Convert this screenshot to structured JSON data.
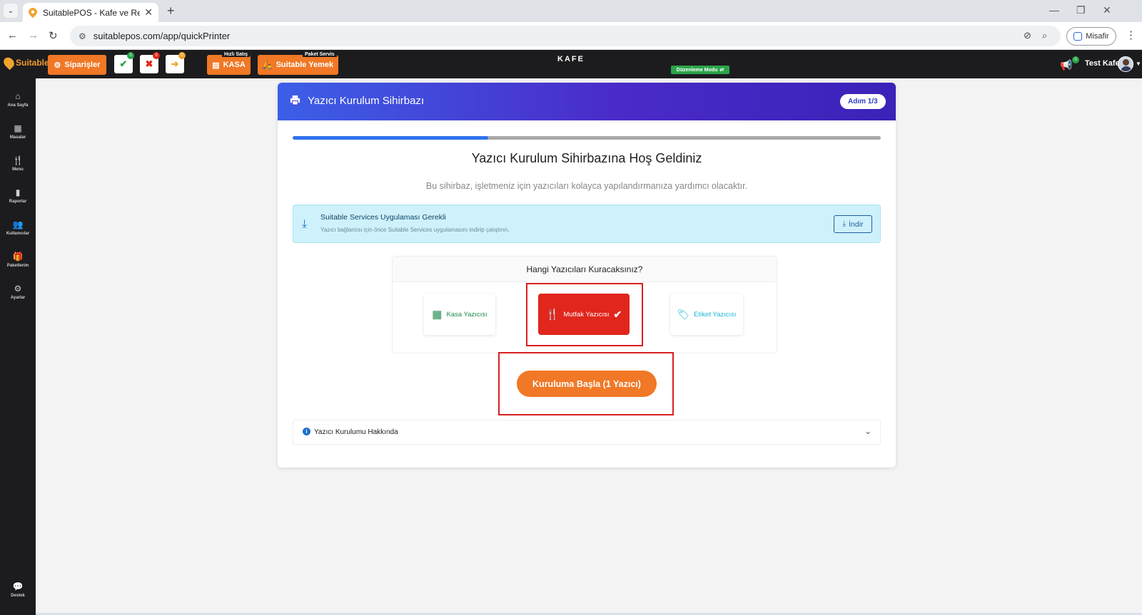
{
  "browser": {
    "tab_title": "SuitablePOS - Kafe ve Restoran",
    "url": "suitablepos.com/app/quickPrinter",
    "guest_label": "Misafir"
  },
  "app": {
    "logo_text": "Suitable",
    "orders_label": "Siparişler",
    "badges": {
      "approved": "0",
      "cancelled": "0",
      "pending": "0"
    },
    "quick_sale_caption": "Hızlı Satış",
    "kasa_label": "KASA",
    "package_caption": "Paket Servis",
    "suitable_yemek_label": "Suitable Yemek",
    "venue": "KAFE",
    "edit_mode": "Düzenleme Modu",
    "notif_count": "0",
    "user_name": "Test Kafe"
  },
  "sidebar": {
    "items": [
      {
        "label": "Ana Sayfa",
        "icon": "home-icon"
      },
      {
        "label": "Masalar",
        "icon": "table-icon"
      },
      {
        "label": "Menu",
        "icon": "utensils-icon"
      },
      {
        "label": "Raporlar",
        "icon": "report-icon"
      },
      {
        "label": "Kullanıcılar",
        "icon": "users-icon"
      },
      {
        "label": "Paketlerim",
        "icon": "gift-icon"
      },
      {
        "label": "Ayarlar",
        "icon": "cogs-icon"
      }
    ],
    "support_label": "Destek"
  },
  "wizard": {
    "title": "Yazıcı Kurulum Sihirbazı",
    "step": "Adım 1/3",
    "progress_fraction": 0.333,
    "welcome": "Yazıcı Kurulum Sihirbazına Hoş Geldiniz",
    "subtitle": "Bu sihirbaz, işletmeniz için yazıcıları kolayca yapılandırmanıza yardımcı olacaktır.",
    "alert_title": "Suitable Services Uygulaması Gerekli",
    "alert_text": "Yazıcı bağlantısı için önce Suitable Services uygulamasını indirip çalıştırın.",
    "download_label": "İndir",
    "question": "Hangi Yazıcıları Kuracaksınız?",
    "printers": [
      {
        "label": "Kasa Yazıcısı",
        "selected": false,
        "color": "#1e8a4c"
      },
      {
        "label": "Mutfak Yazıcısı",
        "selected": true,
        "color": "#e0261d"
      },
      {
        "label": "Etiket Yazıcısı",
        "selected": false,
        "color": "#1fb8d6"
      }
    ],
    "start_label": "Kuruluma Başla (1 Yazıcı)",
    "about_label": "Yazıcı Kurulumu Hakkında"
  },
  "colors": {
    "accent": "#f07826",
    "header_start": "#3c5fe8",
    "header_end": "#3b22b8"
  }
}
